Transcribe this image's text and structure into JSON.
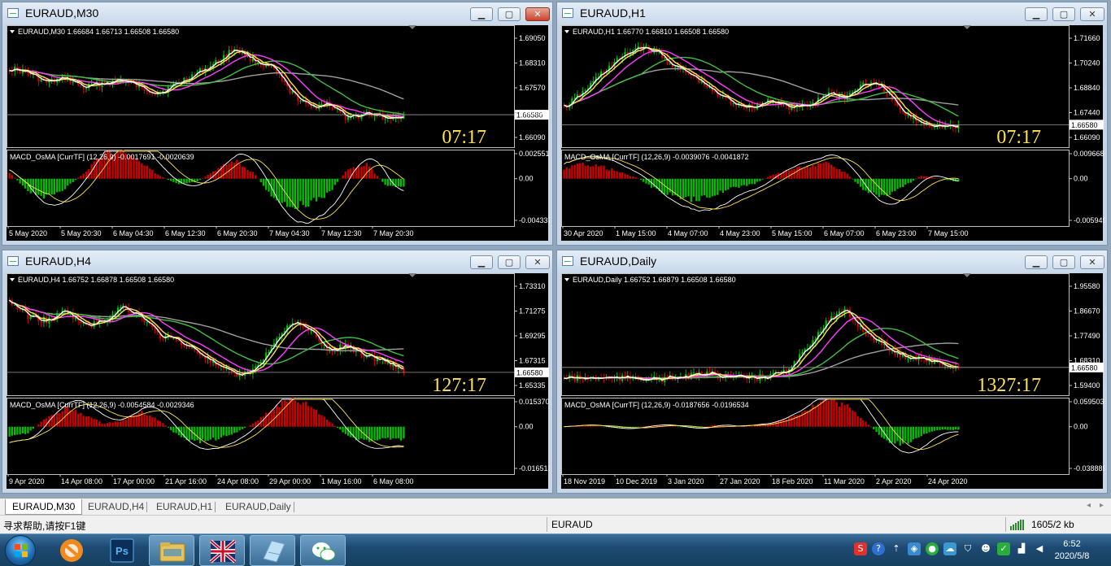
{
  "windows": [
    {
      "id": "m30",
      "title": "EURAUD,M30",
      "info": "EURAUD,M30  1.66684 1.66713 1.66508 1.66580",
      "price_labels": [
        "1.69050",
        "1.68310",
        "1.67570",
        "1.66830",
        "1.66090"
      ],
      "current_price": "1.66580",
      "timer": "07:17",
      "macd_label": "MACD_OsMA [CurrTF] (12,26,9) -0.0017691 -0.0020639",
      "macd_labels": [
        "0.0025512",
        "0.00",
        "-0.004337"
      ],
      "time_labels": [
        "5 May 2020",
        "5 May 20:30",
        "6 May 04:30",
        "6 May 12:30",
        "6 May 20:30",
        "7 May 04:30",
        "7 May 12:30",
        "7 May 20:30"
      ],
      "active": true
    },
    {
      "id": "h1",
      "title": "EURAUD,H1",
      "info": "EURAUD,H1  1.66770 1.66810 1.66508 1.66580",
      "price_labels": [
        "1.71660",
        "1.70240",
        "1.68840",
        "1.67440",
        "1.66090"
      ],
      "current_price": "1.66580",
      "timer": "07:17",
      "macd_label": "MACD_OsMA [CurrTF] (12,26,9) -0.0039076 -0.0041872",
      "macd_labels": [
        "0.0096682",
        "0.00",
        "-0.005949"
      ],
      "time_labels": [
        "30 Apr 2020",
        "1 May 15:00",
        "4 May 07:00",
        "4 May 23:00",
        "5 May 15:00",
        "6 May 07:00",
        "6 May 23:00",
        "7 May 15:00"
      ],
      "active": false
    },
    {
      "id": "h4",
      "title": "EURAUD,H4",
      "info": "EURAUD,H4  1.66752 1.66878 1.66508 1.66580",
      "price_labels": [
        "1.73310",
        "1.71275",
        "1.69295",
        "1.67315",
        "1.65335"
      ],
      "current_price": "1.66580",
      "timer": "127:17",
      "macd_label": "MACD_OsMA [CurrTF] (12,26,9) -0.0054584 -0.0029346",
      "macd_labels": [
        "0.0153708",
        "0.00",
        "-0.016513"
      ],
      "time_labels": [
        "9 Apr 2020",
        "14 Apr 08:00",
        "17 Apr 00:00",
        "21 Apr 16:00",
        "24 Apr 08:00",
        "29 Apr 00:00",
        "1 May 16:00",
        "6 May 08:00"
      ],
      "active": false
    },
    {
      "id": "daily",
      "title": "EURAUD,Daily",
      "info": "EURAUD,Daily  1.66752 1.66879 1.66508 1.66580",
      "price_labels": [
        "1.95580",
        "1.86670",
        "1.77490",
        "1.68310",
        "1.59400"
      ],
      "current_price": "1.66580",
      "timer": "1327:17",
      "macd_label": "MACD_OsMA [CurrTF] (12,26,9) -0.0187656 -0.0196534",
      "macd_labels": [
        "0.0595038",
        "0.00",
        "-0.038889"
      ],
      "time_labels": [
        "18 Nov 2019",
        "10 Dec 2019",
        "3 Jan 2020",
        "27 Jan 2020",
        "18 Feb 2020",
        "11 Mar 2020",
        "2 Apr 2020",
        "24 Apr 2020"
      ],
      "active": false
    }
  ],
  "tabs": [
    "EURAUD,M30",
    "EURAUD,H4",
    "EURAUD,H1",
    "EURAUD,Daily"
  ],
  "status": {
    "help": "寻求帮助,请按F1键",
    "symbol": "EURAUD",
    "traffic": "1605/2 kb"
  },
  "clock": {
    "time": "6:52",
    "date": "2020/5/8"
  },
  "colors": {
    "bull": "#00c000",
    "bear": "#d00000",
    "ma_white": "#ffffff",
    "ma_yellow": "#ffe34a",
    "ma_magenta": "#ff3cff",
    "ma_green": "#40c040",
    "ma_gray": "#a0a0a0",
    "timer": "#ffe34a"
  }
}
